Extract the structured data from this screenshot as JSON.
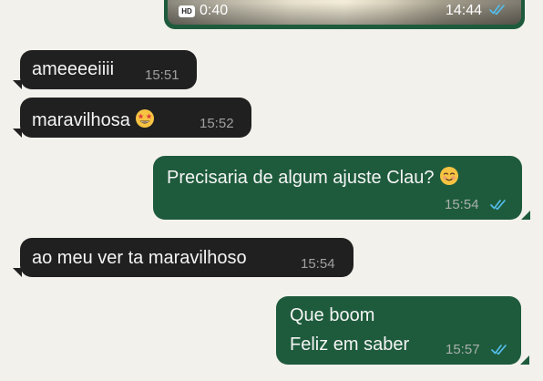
{
  "video_message": {
    "hd_badge": "HD",
    "duration": "0:40",
    "time": "14:44",
    "status": "read",
    "check_color": "#53bdeb"
  },
  "messages": [
    {
      "direction": "incoming",
      "text": "ameeeeiiii",
      "time": "15:51"
    },
    {
      "direction": "incoming",
      "text": "maravilhosa",
      "emoji": "star-struck-emoji",
      "time": "15:52"
    },
    {
      "direction": "outgoing",
      "text": "Precisaria de algum ajuste Clau?",
      "emoji": "smiling-face-emoji",
      "time": "15:54",
      "status": "read"
    },
    {
      "direction": "incoming",
      "text": "ao meu ver ta maravilhoso",
      "time": "15:54"
    },
    {
      "direction": "outgoing",
      "lines": [
        "Que boom",
        "Feliz em saber"
      ],
      "time": "15:57",
      "status": "read"
    }
  ],
  "colors": {
    "background": "#f3f1ec",
    "incoming_bubble": "#202020",
    "outgoing_bubble": "#1e5b3c",
    "read_check": "#53bdeb"
  }
}
